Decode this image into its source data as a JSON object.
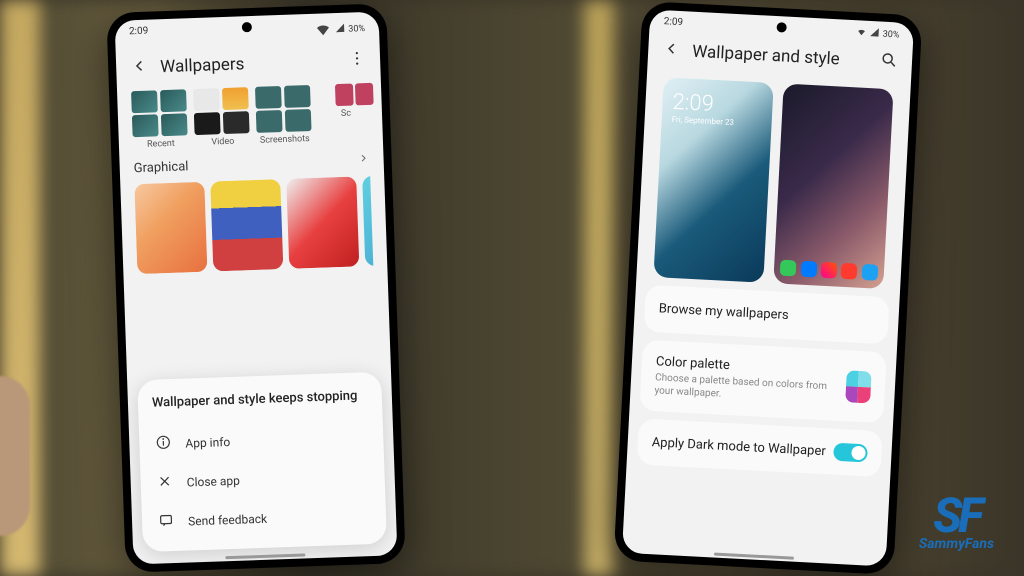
{
  "status": {
    "time": "2:09",
    "battery": "30%"
  },
  "left": {
    "title": "Wallpapers",
    "thumbs": [
      {
        "label": "Recent"
      },
      {
        "label": "Video"
      },
      {
        "label": "Screenshots"
      },
      {
        "label": "Sc"
      }
    ],
    "section_graphical": "Graphical",
    "dialog": {
      "title": "Wallpaper and style keeps stopping",
      "app_info": "App info",
      "close_app": "Close app",
      "send_feedback": "Send feedback"
    }
  },
  "right": {
    "title": "Wallpaper and style",
    "lock_time": "2:09",
    "lock_date": "Fri, September 23",
    "browse": "Browse my wallpapers",
    "palette": {
      "title": "Color palette",
      "sub": "Choose a palette based on colors from your wallpaper.",
      "colors": [
        "#4dd0e1",
        "#80deea",
        "#ab47bc",
        "#ec407a"
      ]
    },
    "dark_mode": "Apply Dark mode to Wallpaper"
  },
  "watermark": {
    "logo": "SF",
    "text": "SammyFans"
  }
}
